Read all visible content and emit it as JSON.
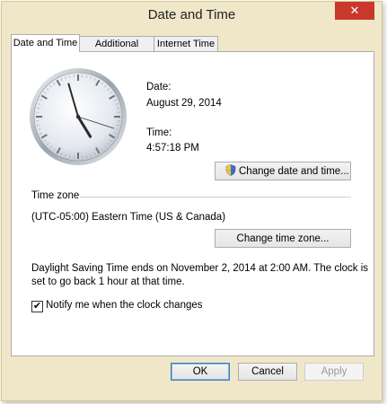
{
  "window": {
    "title": "Date and Time",
    "close_glyph": "✕"
  },
  "tabs": [
    {
      "label": "Date and Time",
      "active": true
    },
    {
      "label": "Additional Clocks",
      "active": false
    },
    {
      "label": "Internet Time",
      "active": false
    }
  ],
  "clock": {
    "hour": 4,
    "minute": 57,
    "second": 18
  },
  "date_section": {
    "date_label": "Date:",
    "date_value": "August 29, 2014",
    "time_label": "Time:",
    "time_value": "4:57:18 PM",
    "change_button": "Change date and time...",
    "shield_icon": "uac-shield-icon"
  },
  "timezone": {
    "heading": "Time zone",
    "value": "(UTC-05:00) Eastern Time (US & Canada)",
    "change_button": "Change time zone..."
  },
  "dst": {
    "line1": "Daylight Saving Time ends on November 2, 2014 at 2:00 AM. The clock is",
    "line2": "set to go back 1 hour at that time.",
    "notify_label": "Notify me when the clock changes",
    "notify_checked": true,
    "check_glyph": "✔"
  },
  "footer": {
    "ok": "OK",
    "cancel": "Cancel",
    "apply": "Apply"
  },
  "colors": {
    "frame": "#f0e7c9",
    "close": "#c8382b",
    "accent": "#3c7fb1"
  }
}
